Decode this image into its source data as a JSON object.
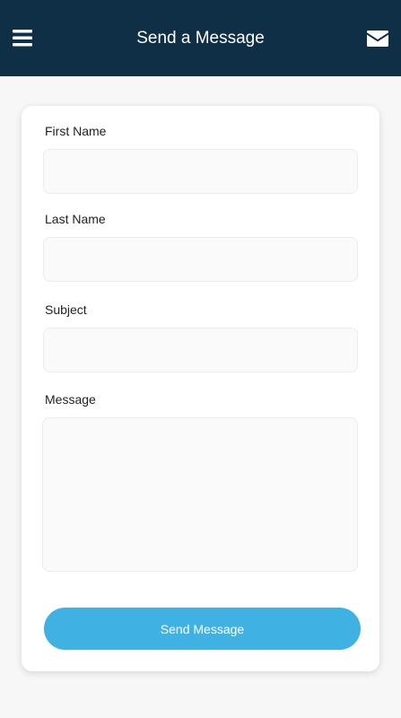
{
  "header": {
    "title": "Send a Message",
    "menu_icon": "hamburger-menu-icon",
    "mail_icon": "envelope-icon",
    "background": "#0f2f46"
  },
  "form": {
    "first_name": {
      "label": "First Name",
      "value": ""
    },
    "last_name": {
      "label": "Last Name",
      "value": ""
    },
    "subject": {
      "label": "Subject",
      "value": ""
    },
    "message": {
      "label": "Message",
      "value": ""
    },
    "submit_label": "Send Message",
    "accent": "#3fb1e3"
  }
}
